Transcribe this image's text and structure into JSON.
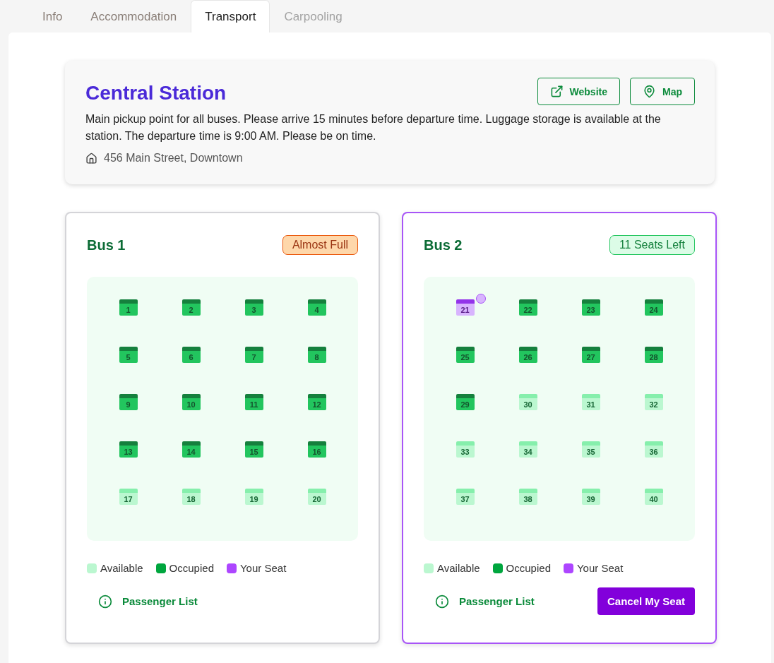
{
  "tabs": [
    {
      "label": "Info",
      "selected": false,
      "disabled": false
    },
    {
      "label": "Accommodation",
      "selected": false,
      "disabled": false
    },
    {
      "label": "Transport",
      "selected": true,
      "disabled": false
    },
    {
      "label": "Carpooling",
      "selected": false,
      "disabled": true
    }
  ],
  "station": {
    "title": "Central Station",
    "buttons": [
      {
        "label": "Website",
        "kind": "website"
      },
      {
        "label": "Map",
        "kind": "map"
      }
    ],
    "description": "Main pickup point for all buses. Please arrive 15 minutes before departure time. Luggage storage is available at the station. The departure time is 9:00 AM. Please be on time.",
    "address": "456 Main Street, Downtown"
  },
  "buses": [
    {
      "name": "Bus 1",
      "selected": false,
      "badge": {
        "label": "Almost Full",
        "kind": "warning"
      },
      "seats": [
        {
          "number": "1",
          "kind": "occupied",
          "avatar": false
        },
        {
          "number": "2",
          "kind": "occupied",
          "avatar": false
        },
        {
          "number": "3",
          "kind": "occupied",
          "avatar": false
        },
        {
          "number": "4",
          "kind": "occupied",
          "avatar": false
        },
        {
          "number": "5",
          "kind": "occupied",
          "avatar": false
        },
        {
          "number": "6",
          "kind": "occupied",
          "avatar": false
        },
        {
          "number": "7",
          "kind": "occupied",
          "avatar": false
        },
        {
          "number": "8",
          "kind": "occupied",
          "avatar": false
        },
        {
          "number": "9",
          "kind": "occupied",
          "avatar": false
        },
        {
          "number": "10",
          "kind": "occupied",
          "avatar": false
        },
        {
          "number": "11",
          "kind": "occupied",
          "avatar": false
        },
        {
          "number": "12",
          "kind": "occupied",
          "avatar": false
        },
        {
          "number": "13",
          "kind": "occupied",
          "avatar": false
        },
        {
          "number": "14",
          "kind": "occupied",
          "avatar": false
        },
        {
          "number": "15",
          "kind": "occupied",
          "avatar": false
        },
        {
          "number": "16",
          "kind": "occupied",
          "avatar": false
        },
        {
          "number": "17",
          "kind": "available",
          "avatar": false
        },
        {
          "number": "18",
          "kind": "available",
          "avatar": false
        },
        {
          "number": "19",
          "kind": "available",
          "avatar": false
        },
        {
          "number": "20",
          "kind": "available",
          "avatar": false
        }
      ],
      "legend": [
        {
          "label": "Available",
          "color": "#bbf7d0"
        },
        {
          "label": "Occupied",
          "color": "#00a63e"
        },
        {
          "label": "Your Seat",
          "color": "#ad46ff"
        }
      ],
      "passenger_link": "Passenger List"
    },
    {
      "name": "Bus 2",
      "selected": true,
      "badge": {
        "label": "11 Seats Left",
        "kind": "ok"
      },
      "seats": [
        {
          "number": "21",
          "kind": "mine",
          "avatar": true
        },
        {
          "number": "22",
          "kind": "occupied",
          "avatar": false
        },
        {
          "number": "23",
          "kind": "occupied",
          "avatar": false
        },
        {
          "number": "24",
          "kind": "occupied",
          "avatar": false
        },
        {
          "number": "25",
          "kind": "occupied",
          "avatar": false
        },
        {
          "number": "26",
          "kind": "occupied",
          "avatar": false
        },
        {
          "number": "27",
          "kind": "occupied",
          "avatar": false
        },
        {
          "number": "28",
          "kind": "occupied",
          "avatar": false
        },
        {
          "number": "29",
          "kind": "occupied",
          "avatar": false
        },
        {
          "number": "30",
          "kind": "available",
          "avatar": false
        },
        {
          "number": "31",
          "kind": "available",
          "avatar": false
        },
        {
          "number": "32",
          "kind": "available",
          "avatar": false
        },
        {
          "number": "33",
          "kind": "available",
          "avatar": false
        },
        {
          "number": "34",
          "kind": "available",
          "avatar": false
        },
        {
          "number": "35",
          "kind": "available",
          "avatar": false
        },
        {
          "number": "36",
          "kind": "available",
          "avatar": false
        },
        {
          "number": "37",
          "kind": "available",
          "avatar": false
        },
        {
          "number": "38",
          "kind": "available",
          "avatar": false
        },
        {
          "number": "39",
          "kind": "available",
          "avatar": false
        },
        {
          "number": "40",
          "kind": "available",
          "avatar": false
        }
      ],
      "legend": [
        {
          "label": "Available",
          "color": "#bbf7d0"
        },
        {
          "label": "Occupied",
          "color": "#00a63e"
        },
        {
          "label": "Your Seat",
          "color": "#ad46ff"
        }
      ],
      "passenger_link": "Passenger List",
      "cancel_button": "Cancel My Seat"
    }
  ]
}
